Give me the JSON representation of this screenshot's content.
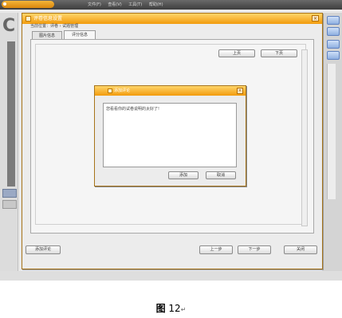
{
  "app": {
    "logo_text": "",
    "menu": [
      "文件(F)",
      "查看(V)",
      "工具(T)",
      "帮助(H)"
    ],
    "left_letter": "C"
  },
  "dialog": {
    "title": "评卷信息设置",
    "tabs": [
      "图片信息",
      "评分信息"
    ],
    "breadcrumb": "当前位置：评卷 › 试题管理",
    "top_buttons": [
      "上页",
      "下页"
    ],
    "bottom_buttons": {
      "add_review": "添加评论",
      "prev": "上一步",
      "next": "下一步",
      "close": "关闭"
    }
  },
  "modal": {
    "title": "添加评论",
    "text": "您看看你的试卷说明的太好了!",
    "ok": "添加",
    "cancel": "取消"
  },
  "caption": {
    "label": "图",
    "number": "12"
  }
}
